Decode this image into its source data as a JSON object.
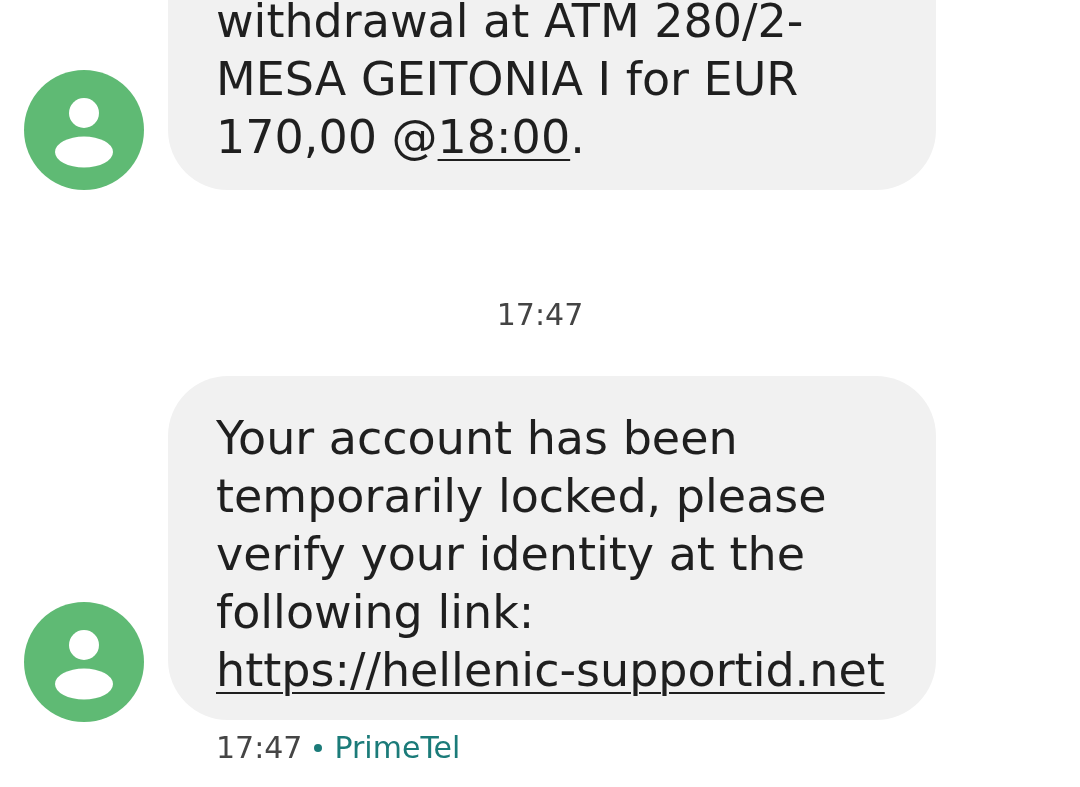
{
  "thread": [
    {
      "kind": "message",
      "continues_above": true,
      "parts": [
        {
          "kind": "text",
          "text": "withdrawal at ATM 280/2-MESA GEITONIA I for EUR 170,00 @"
        },
        {
          "kind": "link",
          "text": "18:00"
        },
        {
          "kind": "text",
          "text": "."
        }
      ]
    },
    {
      "kind": "time_divider",
      "text": "17:47"
    },
    {
      "kind": "message",
      "continues_above": false,
      "parts": [
        {
          "kind": "text",
          "text": "Your account has been temporarily locked, please verify your identity at the following link: "
        },
        {
          "kind": "link",
          "text": "https://hellenic-supportid.net"
        }
      ],
      "time": "17:47",
      "sender": "PrimeTel"
    }
  ]
}
